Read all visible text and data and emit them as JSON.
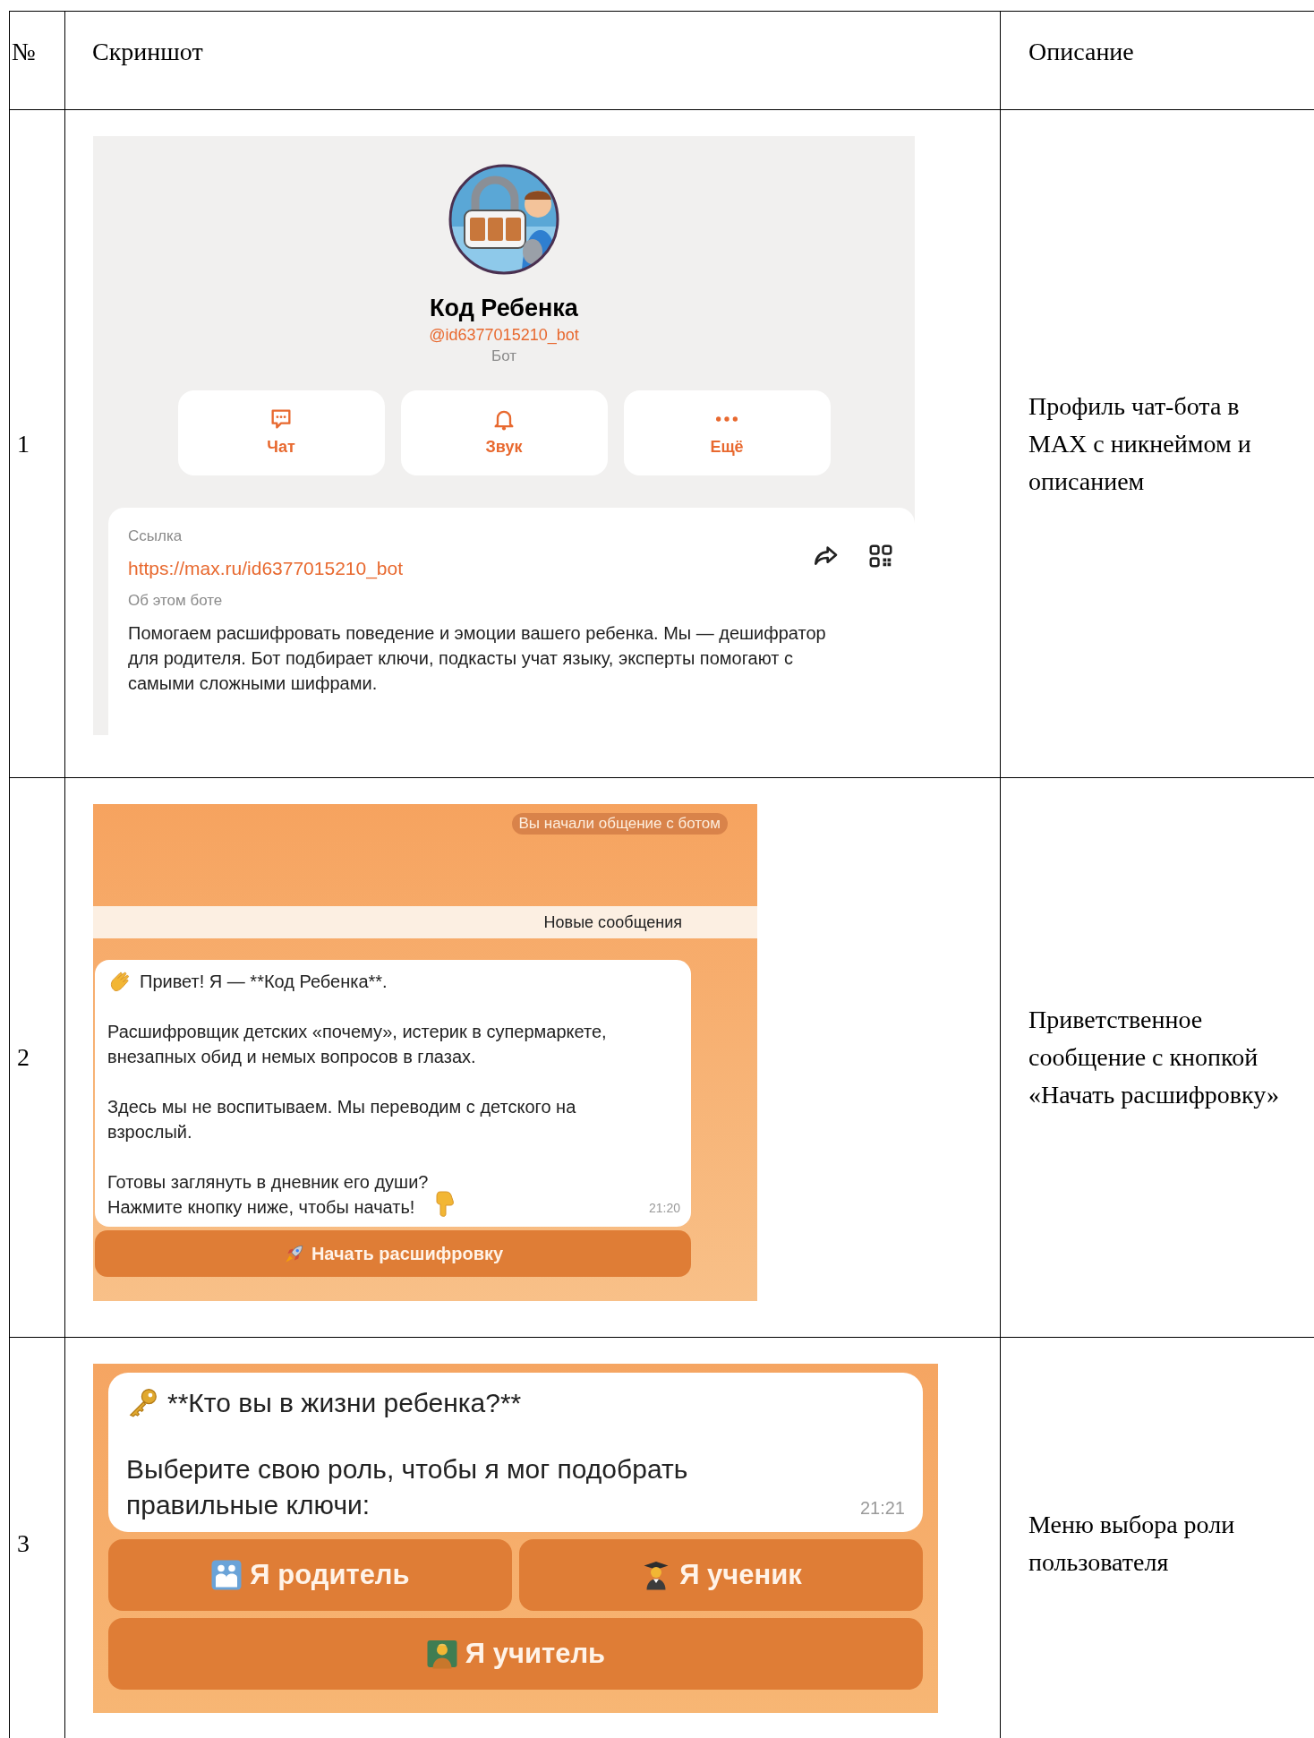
{
  "table": {
    "columns": [
      "№",
      "Скриншот",
      "Описание"
    ],
    "rows": [
      {
        "number": "1",
        "description": "Профиль чат-бота в MAX с никнеймом и описанием",
        "screenshot": {
          "kind": "profile",
          "name": "Код Ребенка",
          "handle": "@id6377015210_bot",
          "type": "Бот",
          "actions": [
            {
              "label": "Чат"
            },
            {
              "label": "Звук"
            },
            {
              "label": "Ещё"
            }
          ],
          "link_label": "Ссылка",
          "link": "https://max.ru/id6377015210_bot",
          "about_label": "Об этом боте",
          "about": "Помогаем расшифровать поведение и эмоции вашего ребенка. Мы — дешифратор для родителя. Бот подбирает ключи, подкасты учат языку, эксперты помогают с самыми сложными шифрами."
        }
      },
      {
        "number": "2",
        "description": "Приветственное сообщение с кнопкой «Начать расшифровку»",
        "screenshot": {
          "kind": "welcome",
          "system_badge": "Вы начали общение с ботом",
          "divider": "Новые сообщения",
          "paragraphs": [
            {
              "text": "Привет! Я — **Код Ребенка**."
            },
            {
              "text": "Расшифровщик детских «почему», истерик в супермаркете, внезапных обид и немых вопросов в глазах."
            },
            {
              "text": "Здесь мы не воспитываем. Мы переводим с детского на взрослый."
            },
            {
              "text": "Готовы заглянуть в дневник его души?\nНажмите кнопку ниже, чтобы начать!"
            }
          ],
          "time": "21:20",
          "button_rows": [
            [
              {
                "label": "Начать расшифровку"
              }
            ]
          ]
        }
      },
      {
        "number": "3",
        "description": "Меню выбора роли пользователя",
        "screenshot": {
          "kind": "roles",
          "paragraphs": [
            {
              "text": "**Кто вы в жизни ребенка?**"
            },
            {
              "text": "Выберите свою роль, чтобы я мог подобрать правильные ключи:"
            }
          ],
          "time": "21:21",
          "button_rows": [
            [
              {
                "label": "Я родитель"
              },
              {
                "label": "Я ученик"
              }
            ],
            [
              {
                "label": "Я учитель"
              }
            ]
          ]
        }
      }
    ]
  }
}
